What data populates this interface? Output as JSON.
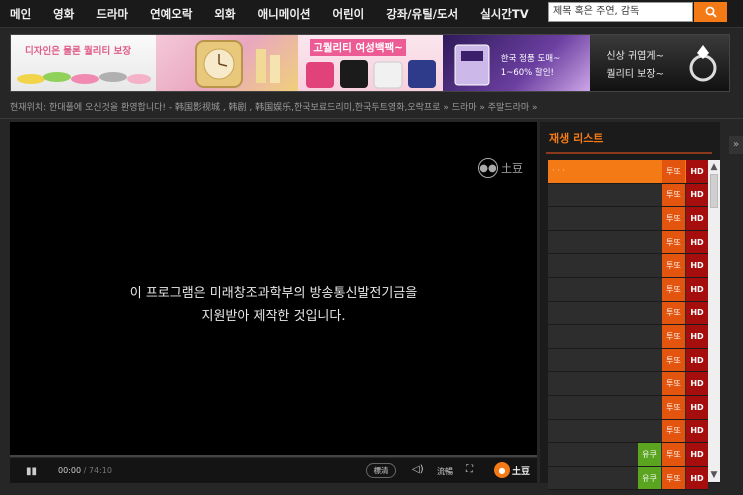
{
  "nav": {
    "items": [
      "메인",
      "영화",
      "드라마",
      "연예오락",
      "외화",
      "애니메이션",
      "어린이",
      "강좌/유틸/도서",
      "실시간TV"
    ],
    "search_placeholder": "제목 혹은 주연, 감독"
  },
  "banner": {
    "ad1_text": "디자인은 물론 퀄리티 보장",
    "ad3_text": "고퀄리티 여성백팩~",
    "ad4_line1": "한국 정품 도매~",
    "ad4_line2": "1~60% 할인!",
    "ad5_line1": "신상 귀엽게~",
    "ad5_line2": "퀄리티 보장~"
  },
  "breadcrumb": "현재위치: 한대플에 오신것을 환영합니다! - 韩国影视城 , 韩剧 , 韩国娱乐,한국보료드리미,한국두트영화,오락프로 » 드라마 » 주말드라마 »",
  "player": {
    "notice_line1": "이 프로그램은 미래창조과학부의 방송통신발전기금을",
    "notice_line2": "지원받아 제작한 것입니다.",
    "logo_text": "土豆",
    "current_time": "00:00",
    "total_time": "/ 74:10",
    "quality_label": "標清",
    "lang_label": "流暢",
    "brand_text": "土豆",
    "progress": 0
  },
  "playlist": {
    "title": "재생 리스트",
    "tudou_label": "투또",
    "youku_label": "유쿠",
    "hd_label": "HD",
    "rows": [
      {
        "title": "· · ·",
        "youku": false,
        "active": true
      },
      {
        "title": "",
        "youku": false,
        "active": false
      },
      {
        "title": "",
        "youku": false,
        "active": false
      },
      {
        "title": "",
        "youku": false,
        "active": false
      },
      {
        "title": "",
        "youku": false,
        "active": false
      },
      {
        "title": "",
        "youku": false,
        "active": false
      },
      {
        "title": "",
        "youku": false,
        "active": false
      },
      {
        "title": "",
        "youku": false,
        "active": false
      },
      {
        "title": "",
        "youku": false,
        "active": false
      },
      {
        "title": "",
        "youku": false,
        "active": false
      },
      {
        "title": "",
        "youku": false,
        "active": false
      },
      {
        "title": "",
        "youku": false,
        "active": false
      },
      {
        "title": "",
        "youku": true,
        "active": false
      },
      {
        "title": "",
        "youku": true,
        "active": false
      }
    ]
  },
  "colors": {
    "accent": "#f47a16",
    "hd": "#a60d0d",
    "youku": "#5aa420"
  }
}
